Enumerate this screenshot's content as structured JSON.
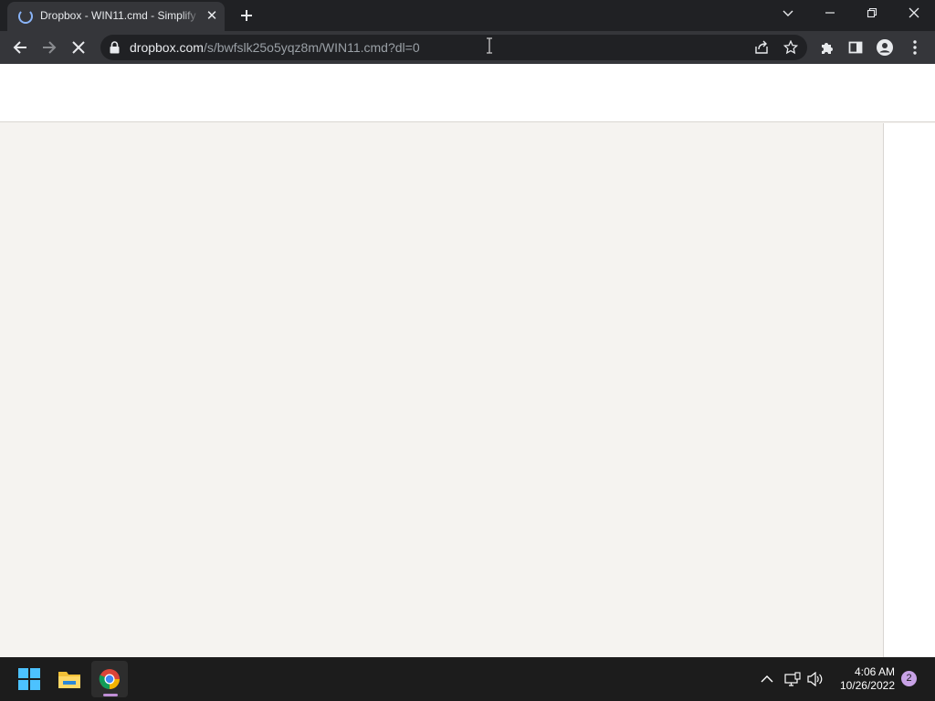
{
  "browser": {
    "tab": {
      "title": "Dropbox - WIN11.cmd - Simplify",
      "close_icon": "close-icon",
      "loading_icon": "spinner-icon"
    },
    "new_tab_icon": "plus-icon",
    "window_controls": [
      "chevron-down-icon",
      "minimize-icon",
      "restore-icon",
      "close-icon"
    ],
    "toolbar": {
      "back_icon": "arrow-left-icon",
      "forward_icon": "arrow-right-icon",
      "stop_icon": "x-icon",
      "address": {
        "host": "dropbox.com",
        "path": "/s/bwfslk25o5yqz8m/WIN11.cmd?dl=0"
      },
      "share_icon": "share-icon",
      "bookmark_icon": "star-icon",
      "extensions_icon": "puzzle-icon",
      "sidepanel_icon": "side-panel-icon",
      "profile_icon": "person-icon",
      "menu_icon": "kebab-icon"
    }
  },
  "taskbar": {
    "apps": [
      "windows-start-icon",
      "file-explorer-icon",
      "chrome-icon"
    ],
    "tray": [
      "chevron-up-icon",
      "network-icon",
      "volume-icon"
    ],
    "time": "4:06 AM",
    "date": "10/26/2022",
    "notification_count": "2"
  },
  "colors": {
    "titlebar": "#202124",
    "toolbar": "#35363a",
    "page_background": "#f5f3f0",
    "taskbar": "#1c1c1c",
    "accent": "#8ab4f8"
  }
}
